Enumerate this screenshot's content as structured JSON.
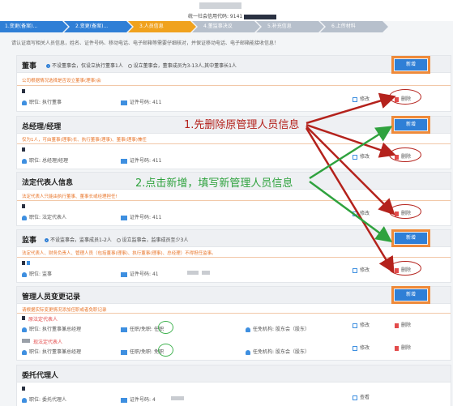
{
  "header": {
    "code_label": "统一社会信用代码: 9141"
  },
  "steps": [
    "1.变更(备案)...",
    "2.变更(备案)...",
    "3.人员信息",
    "4.董监事决议",
    "5.补充信息",
    "6.上传材料"
  ],
  "notice": "请认证填写相关人员信息，姓名、证件号码、移动电话、电子邮箱等需要仔细核对，并保证移动电话、电子邮箱能接收信息！",
  "common": {
    "add": "新增",
    "edit": "修改",
    "delete": "删除",
    "view": "查看",
    "position_label": "职位:",
    "id_label": "证件号码:"
  },
  "directors": {
    "title": "董事",
    "opt1": "不设董事会，仅设立执行董事1人",
    "opt2": "设立董事会，董事成员为3-13人,其中董事长1人",
    "hint": "公司根据情况选择是否设立董事(理事)会",
    "position": "执行董事",
    "id_no": "411"
  },
  "manager": {
    "title": "总经理/经理",
    "hint": "仅为1人，可由董事(理事)长、执行董事(理事)、董事(理事)兼任",
    "position": "总经理/经理",
    "id_no": "411"
  },
  "legal": {
    "title": "法定代表人信息",
    "hint": "法定代表人只能由执行董事、董事长或经理担任!",
    "position": "法定代表人",
    "id_no": "411"
  },
  "supervisors": {
    "title": "监事",
    "opt1": "不设监事会，监事成员1-2人",
    "opt2": "设立监事会，监事成员至少3人",
    "hint": "法定代表人、财务负责人、管理人员（包括董事(理事)、执行董事(理事)、总经理）不得担任监事。",
    "position": "监事",
    "id_no": "41"
  },
  "changes": {
    "title": "管理人员变更记录",
    "hint": "请根据实际变更情况添加任职或者免职记录",
    "rows": [
      {
        "name": "原法定代表人",
        "position": "执行董事兼总经理",
        "type_label": "任职/免职:",
        "type": "任职",
        "org_label": "任免机构:",
        "org": "股东会（股东）"
      },
      {
        "name": "现法定代表人",
        "position": "执行董事兼总经理",
        "type_label": "任职/免职:",
        "type": "免职",
        "org_label": "任免机构:",
        "org": "股东会（股东）"
      }
    ]
  },
  "agent": {
    "title": "委托代理人",
    "position": "委托代理人",
    "id_no": "4"
  },
  "annotations": {
    "step1": "1.先删除原管理人员信息",
    "step2": "2.点击新增，填写新管理人员信息"
  },
  "colors": {
    "primary": "#2f7fd6",
    "orange": "#ee8a3a",
    "red_ink": "#b4221c",
    "green_ink": "#2fa23e"
  }
}
